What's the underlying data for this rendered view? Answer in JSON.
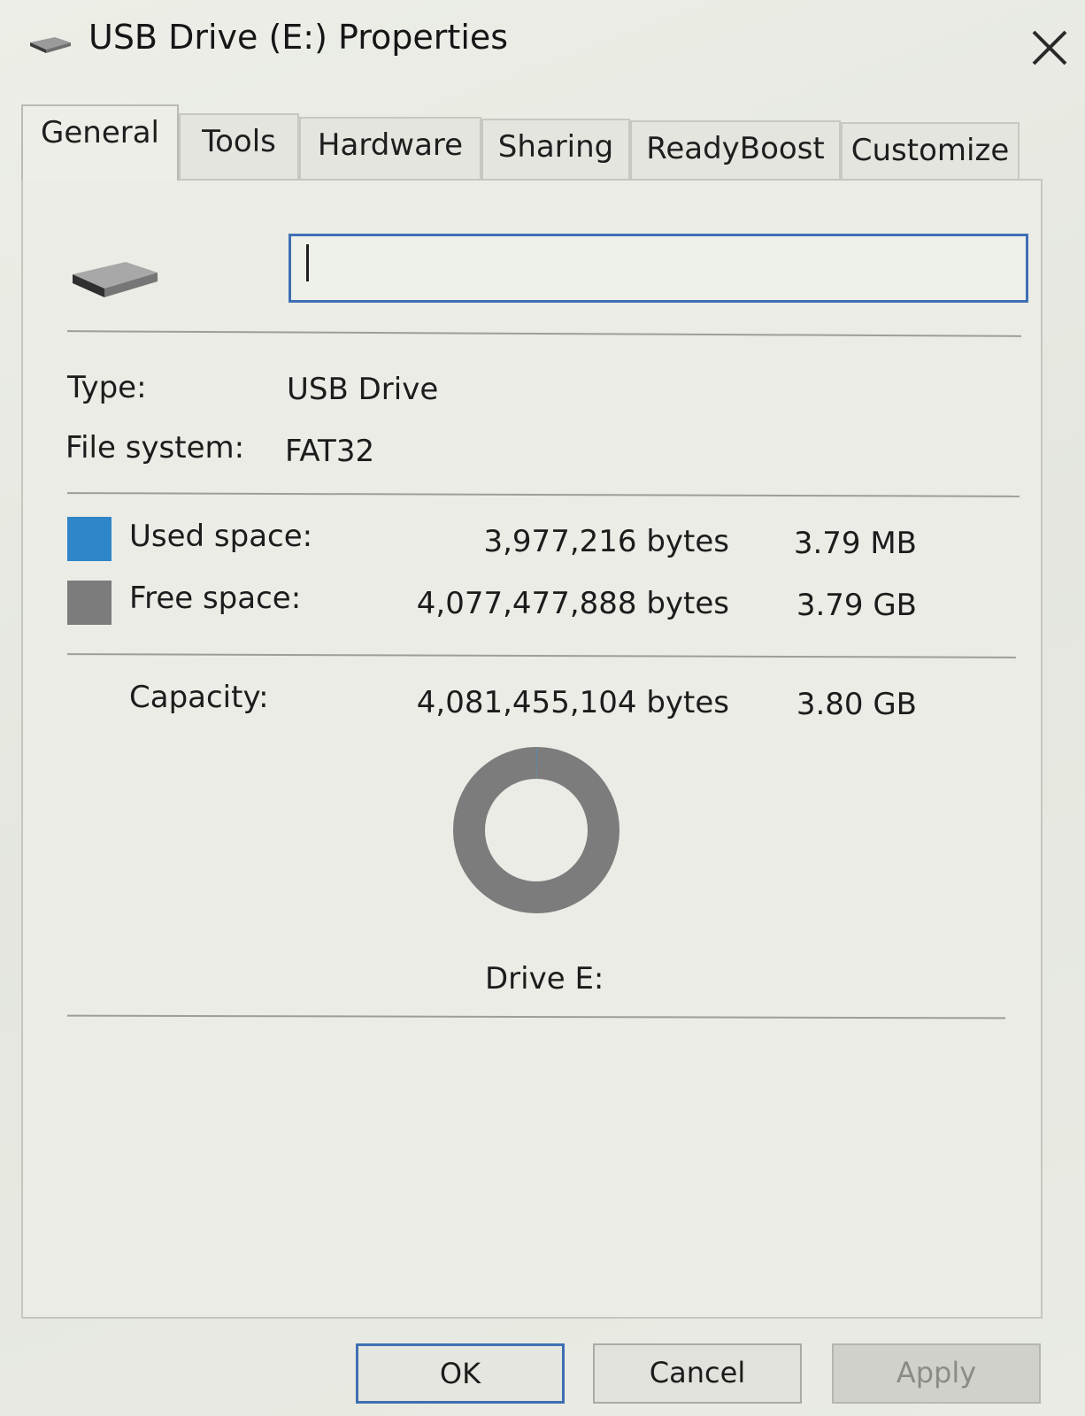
{
  "window": {
    "title": "USB Drive (E:) Properties",
    "icon": "usb-drive-icon",
    "close_icon": "close-icon"
  },
  "tabs": [
    {
      "label": "General",
      "active": true
    },
    {
      "label": "Tools",
      "active": false
    },
    {
      "label": "Hardware",
      "active": false
    },
    {
      "label": "Sharing",
      "active": false
    },
    {
      "label": "ReadyBoost",
      "active": false
    },
    {
      "label": "Customize",
      "active": false
    }
  ],
  "general": {
    "drive_icon": "usb-drive-icon",
    "volume_label_value": "",
    "type_label": "Type:",
    "type_value": "USB Drive",
    "filesystem_label": "File system:",
    "filesystem_value": "FAT32",
    "used": {
      "label": "Used space:",
      "bytes": "3,977,216 bytes",
      "size": "3.79 MB",
      "color": "#2e86c8"
    },
    "free": {
      "label": "Free space:",
      "bytes": "4,077,477,888 bytes",
      "size": "3.79 GB",
      "color": "#7c7c7c"
    },
    "capacity": {
      "label": "Capacity:",
      "bytes": "4,081,455,104 bytes",
      "size": "3.80 GB"
    },
    "drive_caption": "Drive E:"
  },
  "chart_data": {
    "type": "pie",
    "categories": [
      "Used space",
      "Free space"
    ],
    "values": [
      3977216,
      4077477888
    ],
    "colors": [
      "#2e86c8",
      "#7c7c7c"
    ]
  },
  "buttons": {
    "ok": "OK",
    "cancel": "Cancel",
    "apply": "Apply"
  }
}
